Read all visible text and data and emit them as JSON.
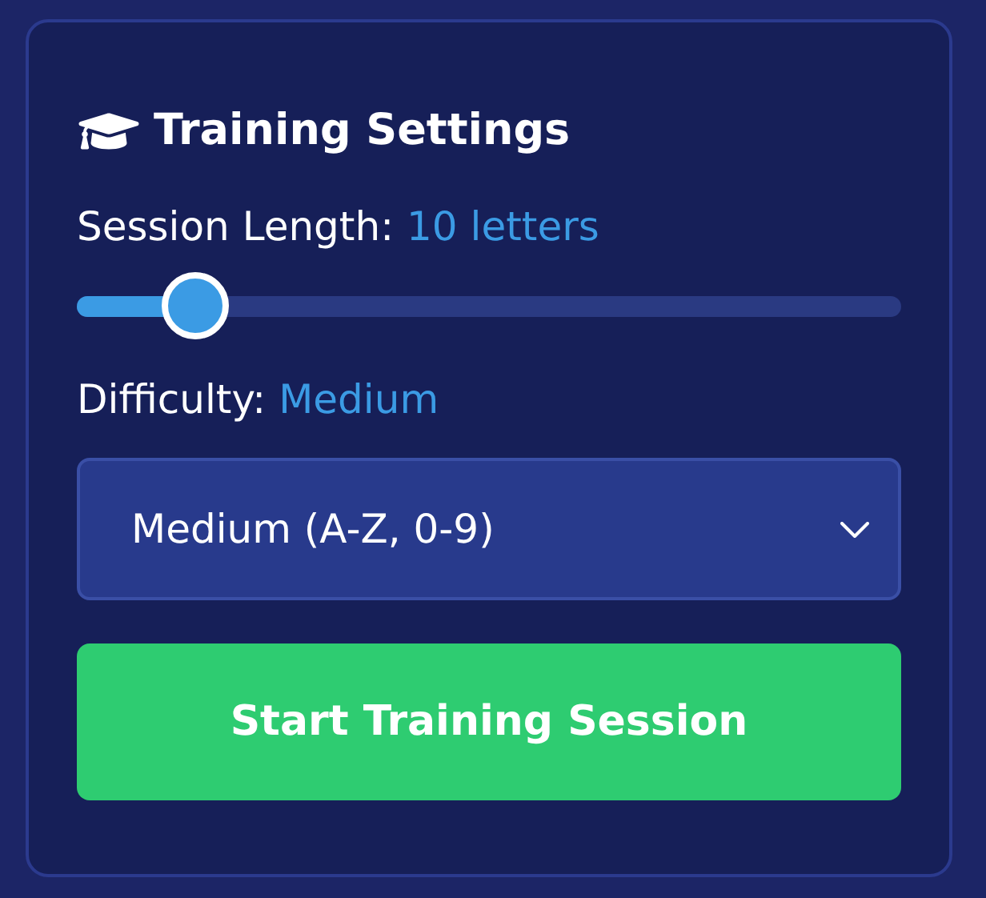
{
  "title": "Training Settings",
  "session_length": {
    "label": "Session Length:",
    "value": "10 letters",
    "level": 0.144
  },
  "difficulty": {
    "label": "Difficulty:",
    "value": "Medium",
    "select_value": "Medium (A-Z, 0-9)"
  },
  "start_button": "Start Training Session"
}
